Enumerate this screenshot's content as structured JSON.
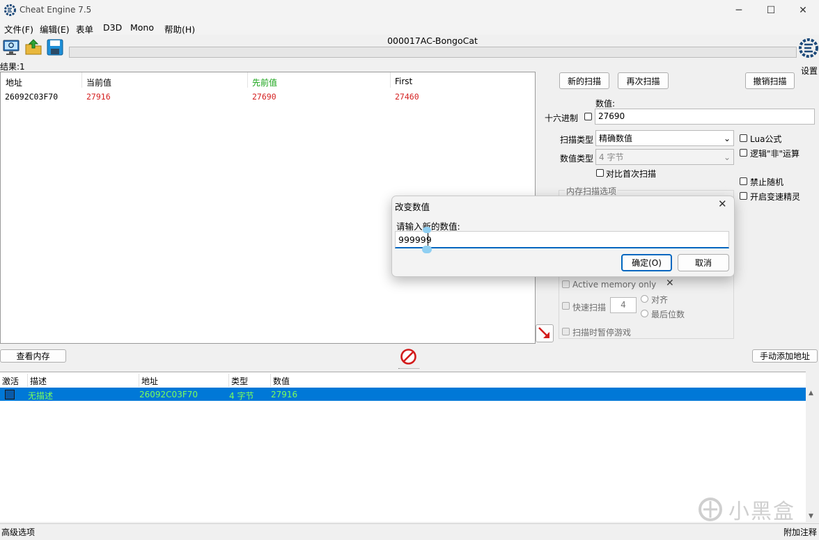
{
  "window": {
    "title": "Cheat Engine 7.5",
    "minimize": "─",
    "maximize": "☐",
    "close": "✕"
  },
  "menu": [
    "文件(F)",
    "编辑(E)",
    "表单",
    "D3D",
    "Mono",
    "帮助(H)"
  ],
  "toolbar": {
    "icons": [
      "open-process-icon",
      "open-file-icon",
      "save-icon"
    ]
  },
  "process": {
    "name": "000017AC-BongoCat",
    "progress": 0
  },
  "settings": {
    "label": "设置"
  },
  "results": {
    "count_label": "结果:1",
    "headers": [
      "地址",
      "当前值",
      "先前值",
      "First"
    ],
    "rows": [
      {
        "address": "26092C03F70",
        "current": "27916",
        "previous": "27690",
        "first": "27460"
      }
    ]
  },
  "scan": {
    "new_scan": "新的扫描",
    "next_scan": "再次扫描",
    "undo_scan": "撤销扫描",
    "value_label": "数值:",
    "hex_label": "十六进制",
    "value": "27690",
    "scan_type_label": "扫描类型",
    "scan_type": "精确数值",
    "value_type_label": "数值类型",
    "value_type": "4 字节",
    "compare_first": "对比首次扫描",
    "lua_formula": "Lua公式",
    "not_op": "逻辑\"非\"运算",
    "no_random": "禁止随机",
    "speedhack": "开启变速精灵",
    "mem_options": "内存扫描选项",
    "active_memory": "Active memory only",
    "fast_scan": "快速扫描",
    "fast_scan_value": "4",
    "align": "对齐",
    "last_digits": "最后位数",
    "pause_game": "扫描时暂停游戏"
  },
  "bottom": {
    "view_memory": "查看内存",
    "add_address": "手动添加地址"
  },
  "addresses": {
    "headers": [
      "激活",
      "描述",
      "地址",
      "类型",
      "数值"
    ],
    "rows": [
      {
        "description": "无描述",
        "address": "26092C03F70",
        "type": "4 字节",
        "value": "27916"
      }
    ]
  },
  "dialog": {
    "title": "改变数值",
    "prompt": "请输入新的数值:",
    "value": "999999",
    "ok": "确定(O)",
    "cancel": "取消",
    "close": "✕"
  },
  "status": {
    "left": "高级选项",
    "right": "附加注释"
  },
  "watermark": "小黑盒",
  "colors": {
    "selection": "#0078d7",
    "changed_value": "#d42020",
    "previous_header": "#16a316",
    "row_text": "#7cff5a"
  }
}
